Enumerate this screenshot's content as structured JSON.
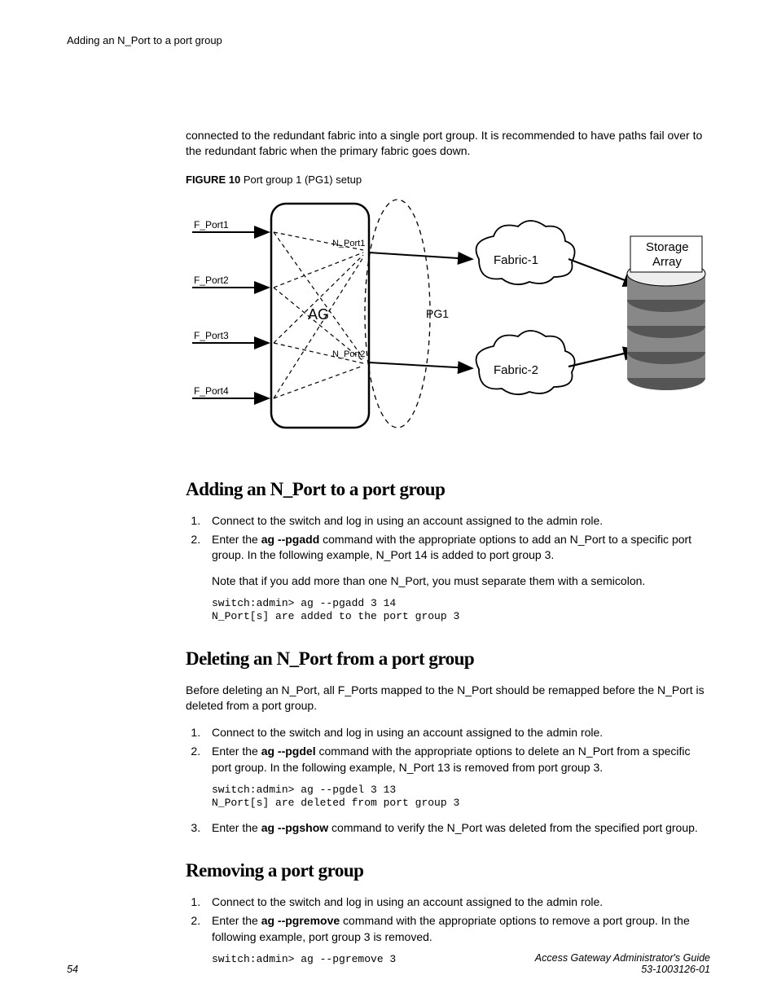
{
  "header": {
    "text": "Adding an N_Port to a port group"
  },
  "intro": {
    "paragraph": "connected to the redundant fabric into a single port group. It is recommended to have paths fail over to the redundant fabric when the primary fabric goes down."
  },
  "figure": {
    "label": "FIGURE 10",
    "caption": "Port group 1 (PG1) setup",
    "labels": {
      "fport1": "F_Port1",
      "fport2": "F_Port2",
      "fport3": "F_Port3",
      "fport4": "F_Port4",
      "nport1": "N_Port1",
      "nport2": "N_Port2",
      "ag": "AG",
      "pg1": "PG1",
      "fabric1": "Fabric-1",
      "fabric2": "Fabric-2",
      "storage1": "Storage",
      "storage2": "Array"
    }
  },
  "sections": {
    "add": {
      "title": "Adding an N_Port to a port group",
      "step1": "Connect to the switch and log in using an account assigned to the admin role.",
      "step2_pre": "Enter the ",
      "step2_cmd": "ag --pgadd",
      "step2_post": " command with the appropriate options to add an N_Port to a specific port group. In the following example, N_Port 14 is added to port group 3.",
      "step2_note": "Note that if you add more than one N_Port, you must separate them with a semicolon.",
      "code": "switch:admin> ag --pgadd 3 14\nN_Port[s] are added to the port group 3"
    },
    "del": {
      "title": "Deleting an N_Port from a port group",
      "prelude": "Before deleting an N_Port, all F_Ports mapped to the N_Port should be remapped before the N_Port is deleted from a port group.",
      "step1": "Connect to the switch and log in using an account assigned to the admin role.",
      "step2_pre": "Enter the ",
      "step2_cmd": "ag --pgdel",
      "step2_post": " command with the appropriate options to delete an N_Port from a specific port group. In the following example, N_Port 13 is removed from port group 3.",
      "code": "switch:admin> ag --pgdel 3 13\nN_Port[s] are deleted from port group 3",
      "step3_pre": "Enter the ",
      "step3_cmd": "ag --pgshow",
      "step3_post": " command to verify the N_Port was deleted from the specified port group."
    },
    "rem": {
      "title": "Removing a port group",
      "step1": "Connect to the switch and log in using an account assigned to the admin role.",
      "step2_pre": "Enter the ",
      "step2_cmd": "ag --pgremove",
      "step2_post": " command with the appropriate options to remove a port group. In the following example, port group 3 is removed.",
      "code": "switch:admin> ag --pgremove 3"
    }
  },
  "footer": {
    "page": "54",
    "title": "Access Gateway Administrator's Guide",
    "docnum": "53-1003126-01"
  }
}
